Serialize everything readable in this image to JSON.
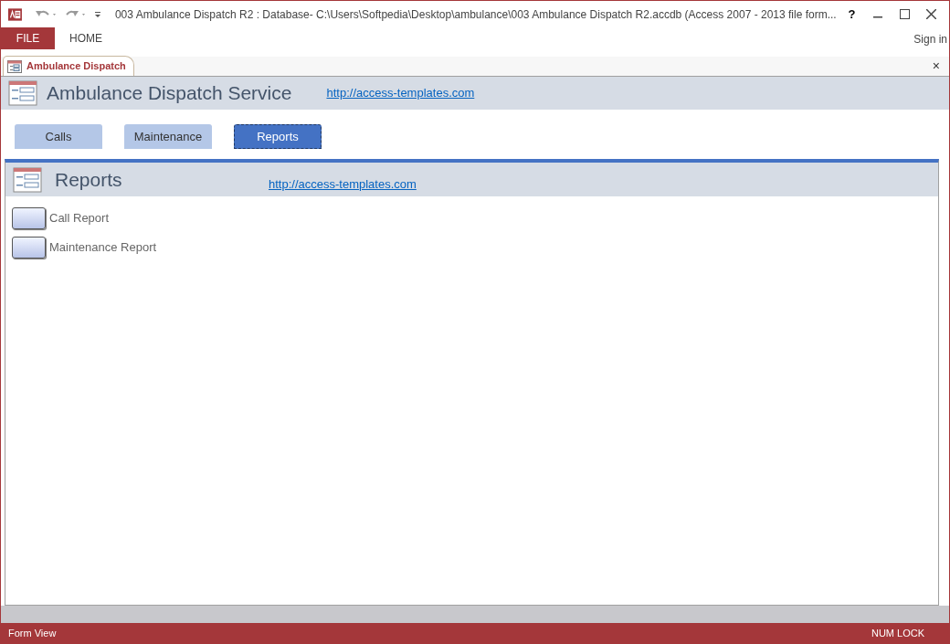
{
  "window": {
    "title": "003 Ambulance Dispatch R2 : Database- C:\\Users\\Softpedia\\Desktop\\ambulance\\003 Ambulance Dispatch R2.accdb (Access 2007 - 2013 file form...",
    "help": "?"
  },
  "ribbon_tabs": [
    {
      "label": "FILE",
      "kind": "file"
    },
    {
      "label": "HOME",
      "kind": "tab"
    }
  ],
  "sign_in": "Sign in",
  "document_tab": {
    "label": "Ambulance Dispatch",
    "close": "×"
  },
  "header": {
    "title": "Ambulance Dispatch Service",
    "link": "http://access-templates.com"
  },
  "nav_buttons": [
    {
      "label": "Calls",
      "selected": false
    },
    {
      "label": "Maintenance",
      "selected": false
    },
    {
      "label": "Reports",
      "selected": true
    }
  ],
  "subform": {
    "title": "Reports",
    "link": "http://access-templates.com",
    "items": [
      {
        "label": "Call Report"
      },
      {
        "label": "Maintenance Report"
      }
    ]
  },
  "status_bar": {
    "left": "Form View",
    "right": "NUM LOCK"
  }
}
